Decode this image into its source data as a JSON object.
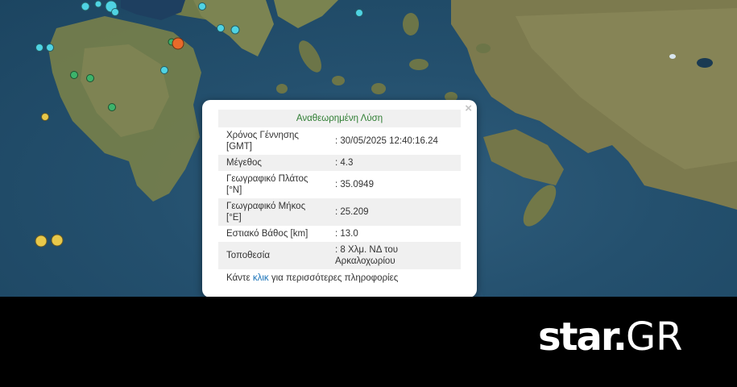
{
  "popup": {
    "title": "Αναθεωρημένη Λύση",
    "close_symbol": "×",
    "rows": [
      {
        "label": "Χρόνος Γέννησης [GMT]",
        "value": ": 30/05/2025 12:40:16.24"
      },
      {
        "label": "Μέγεθος",
        "value": ": 4.3"
      },
      {
        "label": "Γεωγραφικό Πλάτος [°N]",
        "value": ": 35.0949"
      },
      {
        "label": "Γεωγραφικό Μήκος [°E]",
        "value": ": 25.209"
      },
      {
        "label": "Εστιακό Βάθος [km]",
        "value": ": 13.0"
      },
      {
        "label": "Τοποθεσία",
        "value": ": 8 Χλμ. ΝΔ του Αρκαλοχωρίου"
      }
    ],
    "more_prefix": "Κάντε",
    "more_link": "κλικ",
    "more_suffix": "για περισσότερες πληροφορίες"
  },
  "logo": {
    "main": "star.",
    "suffix": "GR"
  },
  "colors": {
    "marker_cyan": "#4fd3e3",
    "marker_green": "#3db36b",
    "marker_yellow": "#e8c84a",
    "marker_orange": "#e86a2a",
    "sea": "#24506e",
    "land": "#6f7a4a",
    "title_green": "#2e7d32",
    "link_blue": "#1a73b8"
  }
}
